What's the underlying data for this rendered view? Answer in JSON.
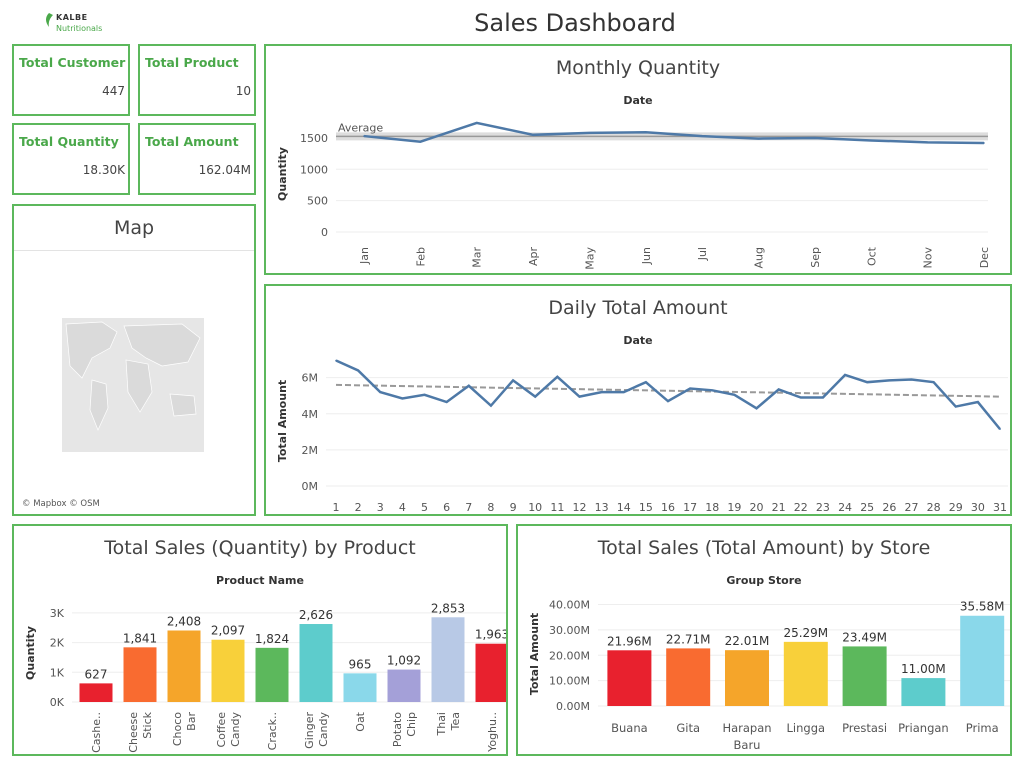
{
  "header": {
    "logo_brand": "KALBE",
    "logo_sub": "Nutritionals",
    "title": "Sales Dashboard"
  },
  "kpis": [
    {
      "label": "Total Customer",
      "value": "447"
    },
    {
      "label": "Total Product",
      "value": "10"
    },
    {
      "label": "Total Quantity",
      "value": "18.30K"
    },
    {
      "label": "Total Amount",
      "value": "162.04M"
    }
  ],
  "map": {
    "title": "Map",
    "attribution": "© Mapbox © OSM"
  },
  "colors": {
    "border": "#5cb85c",
    "line": "#4e79a7",
    "trend": "#999999"
  },
  "chart_data": [
    {
      "id": "monthly",
      "type": "line",
      "title": "Monthly Quantity",
      "xlabel": "Date",
      "ylabel": "Quantity",
      "categories": [
        "Jan",
        "Feb",
        "Mar",
        "Apr",
        "May",
        "Jun",
        "Jul",
        "Aug",
        "Sep",
        "Oct",
        "Nov",
        "Dec"
      ],
      "values": [
        1530,
        1440,
        1740,
        1550,
        1580,
        1590,
        1530,
        1490,
        1500,
        1460,
        1430,
        1420
      ],
      "yticks": [
        0,
        500,
        1000,
        1500
      ],
      "yticklabels": [
        "0",
        "500",
        "1000",
        "1500"
      ],
      "ylim": [
        0,
        1850
      ],
      "reference_line": {
        "label": "Average",
        "value": 1525
      },
      "grid": true
    },
    {
      "id": "daily",
      "type": "line",
      "title": "Daily Total Amount",
      "xlabel": "Date",
      "ylabel": "Total Amount",
      "categories": [
        "1",
        "2",
        "3",
        "4",
        "5",
        "6",
        "7",
        "8",
        "9",
        "10",
        "11",
        "12",
        "13",
        "14",
        "15",
        "16",
        "17",
        "18",
        "19",
        "20",
        "21",
        "22",
        "23",
        "24",
        "25",
        "26",
        "27",
        "28",
        "29",
        "30",
        "31"
      ],
      "values": [
        6.95,
        6.4,
        5.2,
        4.85,
        5.05,
        4.65,
        5.55,
        4.45,
        5.85,
        4.95,
        6.05,
        4.95,
        5.2,
        5.2,
        5.75,
        4.7,
        5.4,
        5.3,
        5.05,
        4.3,
        5.35,
        4.9,
        4.9,
        6.15,
        5.75,
        5.85,
        5.9,
        5.75,
        4.4,
        4.65,
        3.15
      ],
      "yticks": [
        0,
        2,
        4,
        6
      ],
      "yticklabels": [
        "0M",
        "2M",
        "4M",
        "6M"
      ],
      "ylim": [
        0,
        7.2
      ],
      "trend": {
        "start": 5.6,
        "end": 4.95
      },
      "grid": true
    },
    {
      "id": "product",
      "type": "bar",
      "title": "Total Sales (Quantity) by Product",
      "xlabel": "Product Name",
      "ylabel": "Quantity",
      "categories": [
        "Cashe..",
        "Cheese Stick",
        "Choco Bar",
        "Coffee Candy",
        "Crack..",
        "Ginger Candy",
        "Oat",
        "Potato Chip",
        "Thai Tea",
        "Yoghu.."
      ],
      "values": [
        627,
        1841,
        2408,
        2097,
        1824,
        2626,
        965,
        1092,
        2853,
        1963
      ],
      "value_labels": [
        "627",
        "1,841",
        "2,408",
        "2,097",
        "1,824",
        "2,626",
        "965",
        "1,092",
        "2,853",
        "1,963"
      ],
      "colors": [
        "#e8212e",
        "#f96b30",
        "#f5a52a",
        "#f8d03a",
        "#5cb85c",
        "#5dcccc",
        "#8ad8ea",
        "#a4a0d8",
        "#b8c9e6",
        "#e8212e"
      ],
      "yticks": [
        0,
        1000,
        2000,
        3000
      ],
      "yticklabels": [
        "0K",
        "1K",
        "2K",
        "3K"
      ],
      "ylim": [
        0,
        3300
      ],
      "grid": true
    },
    {
      "id": "store",
      "type": "bar",
      "title": "Total Sales (Total Amount) by Store",
      "xlabel": "Group Store",
      "ylabel": "Total Amount",
      "categories": [
        "Buana",
        "Gita",
        "Harapan Baru",
        "Lingga",
        "Prestasi",
        "Priangan",
        "Prima"
      ],
      "values": [
        21.96,
        22.71,
        22.01,
        25.29,
        23.49,
        11.0,
        35.58
      ],
      "value_labels": [
        "21.96M",
        "22.71M",
        "22.01M",
        "25.29M",
        "23.49M",
        "11.00M",
        "35.58M"
      ],
      "colors": [
        "#e8212e",
        "#f96b30",
        "#f5a52a",
        "#f8d03a",
        "#5cb85c",
        "#5dcccc",
        "#8ad8ea"
      ],
      "yticks": [
        0,
        10,
        20,
        30,
        40
      ],
      "yticklabels": [
        "0.00M",
        "10.00M",
        "20.00M",
        "30.00M",
        "40.00M"
      ],
      "ylim": [
        0,
        41
      ],
      "grid": true
    }
  ]
}
